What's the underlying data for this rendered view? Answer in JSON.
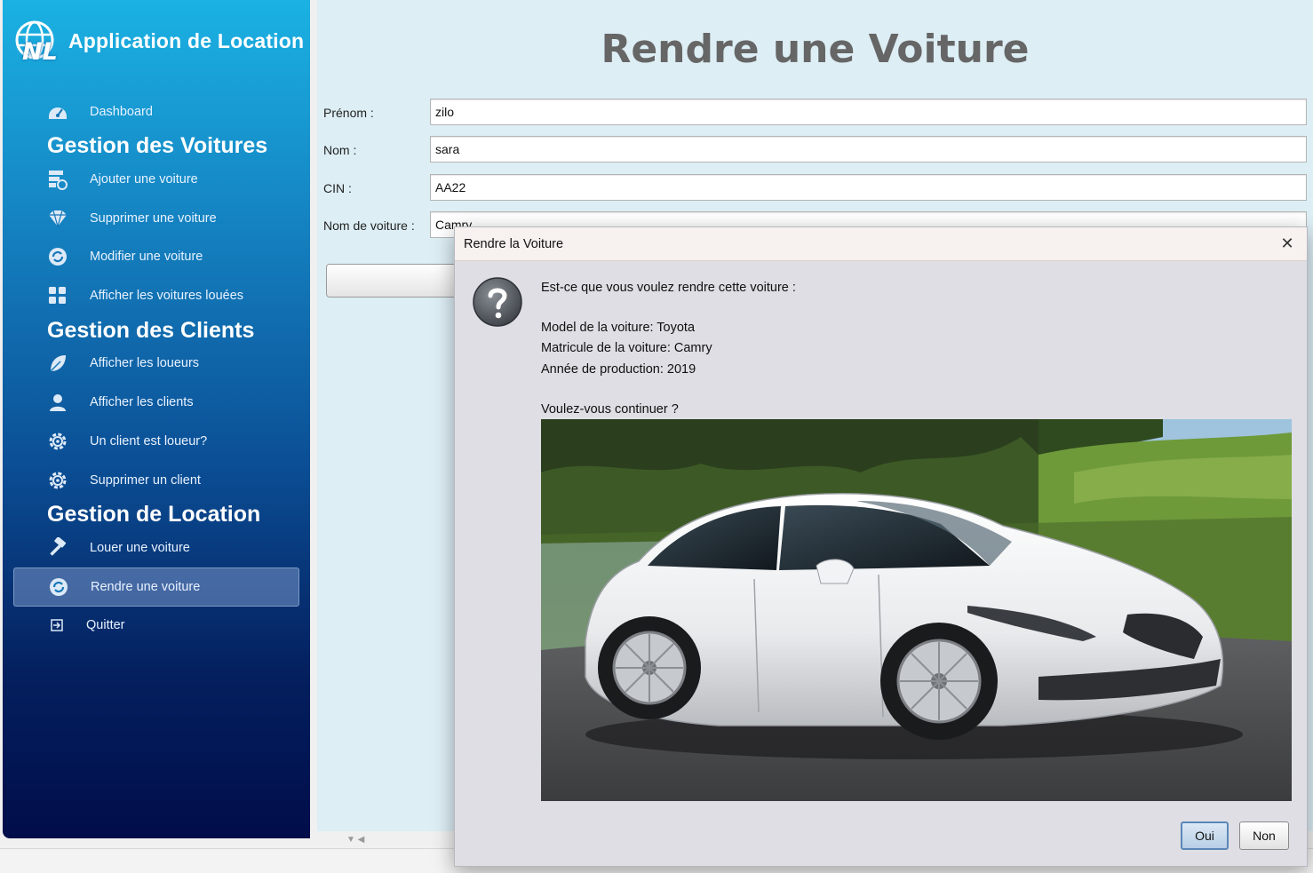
{
  "app": {
    "title": "Application de Location",
    "logo_text": "NL"
  },
  "sidebar": {
    "dashboard": "Dashboard",
    "sections": [
      {
        "title": "Gestion des Voitures",
        "items": [
          {
            "label": "Ajouter une voiture",
            "icon": "car-add-icon"
          },
          {
            "label": "Supprimer une voiture",
            "icon": "diamond-icon"
          },
          {
            "label": "Modifier une voiture",
            "icon": "refresh-icon"
          },
          {
            "label": "Afficher les voitures louées",
            "icon": "grid-icon"
          }
        ]
      },
      {
        "title": "Gestion des Clients",
        "items": [
          {
            "label": "Afficher les loueurs",
            "icon": "leaf-icon"
          },
          {
            "label": "Afficher les clients",
            "icon": "user-icon"
          },
          {
            "label": "Un client est loueur?",
            "icon": "gear-icon"
          },
          {
            "label": "Supprimer un client",
            "icon": "gear-icon"
          }
        ]
      },
      {
        "title": "Gestion de Location",
        "items": [
          {
            "label": "Louer une voiture",
            "icon": "hammer-icon"
          },
          {
            "label": "Rendre une voiture",
            "icon": "refresh-icon",
            "active": true
          }
        ]
      }
    ],
    "quit": "Quitter"
  },
  "main": {
    "title": "Rendre une Voiture",
    "fields": [
      {
        "label": "Prénom :",
        "value": "zilo"
      },
      {
        "label": "Nom :",
        "value": "sara"
      },
      {
        "label": "CIN :",
        "value": "AA22"
      },
      {
        "label": "Nom de voiture :",
        "value": "Camry"
      }
    ]
  },
  "dialog": {
    "title": "Rendre la Voiture",
    "close": "✕",
    "question": "Est-ce que vous voulez rendre cette voiture :",
    "model": "Model de la voiture: Toyota",
    "matricule": "Matricule de la voiture: Camry",
    "annee": "Année de production: 2019",
    "continue": "Voulez-vous continuer ?",
    "buttons": {
      "yes": "Oui",
      "no": "Non"
    }
  },
  "colors": {
    "sidebar_top": "#1bb2e3",
    "sidebar_bottom": "#010d4a",
    "main_bg": "#ddeef5",
    "dialog_bg": "#dedee4",
    "title_gray": "#666666"
  }
}
